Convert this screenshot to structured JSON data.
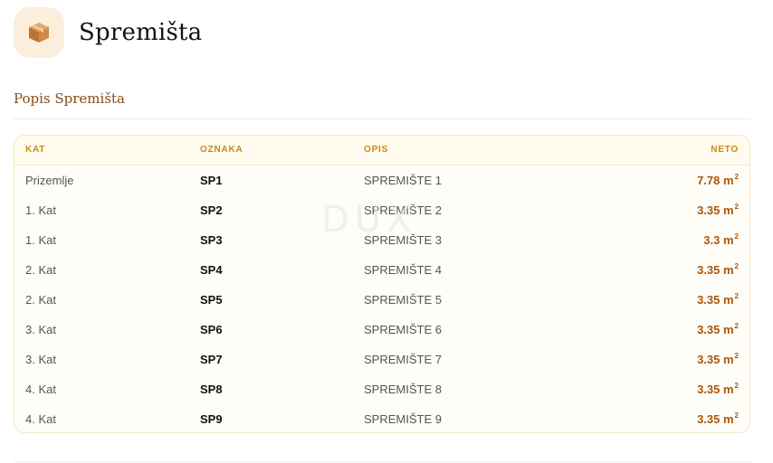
{
  "header": {
    "icon": "package-box-icon",
    "title": "Spremišta"
  },
  "section": {
    "title": "Popis Spremišta"
  },
  "table": {
    "columns": {
      "kat": "KAT",
      "oznaka": "OZNAKA",
      "opis": "OPIS",
      "neto": "NETO"
    },
    "rows": [
      {
        "kat": "Prizemlje",
        "oznaka": "SP1",
        "opis": "SPREMIŠTE 1",
        "neto": "7.78 m",
        "unit_sup": "2"
      },
      {
        "kat": "1. Kat",
        "oznaka": "SP2",
        "opis": "SPREMIŠTE 2",
        "neto": "3.35 m",
        "unit_sup": "2"
      },
      {
        "kat": "1. Kat",
        "oznaka": "SP3",
        "opis": "SPREMIŠTE 3",
        "neto": "3.3 m",
        "unit_sup": "2"
      },
      {
        "kat": "2. Kat",
        "oznaka": "SP4",
        "opis": "SPREMIŠTE 4",
        "neto": "3.35 m",
        "unit_sup": "2"
      },
      {
        "kat": "2. Kat",
        "oznaka": "SP5",
        "opis": "SPREMIŠTE 5",
        "neto": "3.35 m",
        "unit_sup": "2"
      },
      {
        "kat": "3. Kat",
        "oznaka": "SP6",
        "opis": "SPREMIŠTE 6",
        "neto": "3.35 m",
        "unit_sup": "2"
      },
      {
        "kat": "3. Kat",
        "oznaka": "SP7",
        "opis": "SPREMIŠTE 7",
        "neto": "3.35 m",
        "unit_sup": "2"
      },
      {
        "kat": "4. Kat",
        "oznaka": "SP8",
        "opis": "SPREMIŠTE 8",
        "neto": "3.35 m",
        "unit_sup": "2"
      },
      {
        "kat": "4. Kat",
        "oznaka": "SP9",
        "opis": "SPREMIŠTE 9",
        "neto": "3.35 m",
        "unit_sup": "2"
      }
    ]
  },
  "watermark": "DUX",
  "colors": {
    "accent": "#a9570e",
    "header_label": "#c98a12",
    "section_title": "#8a4a12",
    "icon_bg": "#fbeedd"
  }
}
